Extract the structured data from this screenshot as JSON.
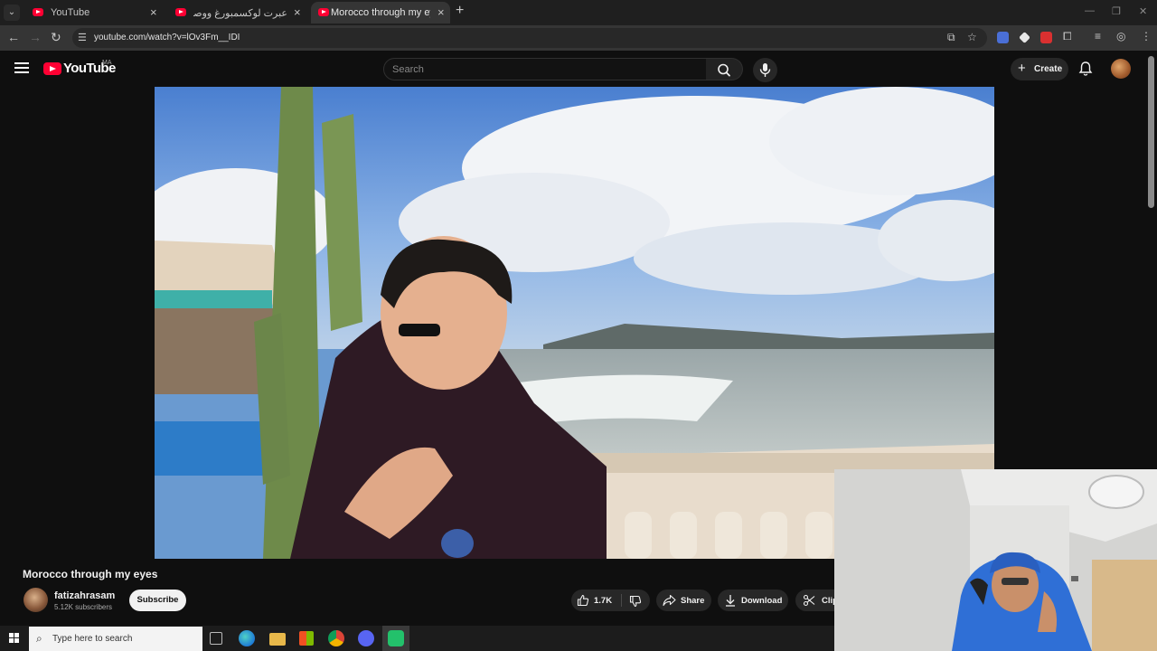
{
  "browser": {
    "tabs": [
      {
        "title": "YouTube",
        "active": false
      },
      {
        "title": "عبرت لوكسمبورغ ووصلت ضواح...",
        "active": false
      },
      {
        "title": "Morocco through my eyes - YouTube",
        "active": true
      }
    ],
    "url": "youtube.com/watch?v=lOv3Fm__IDI"
  },
  "youtube": {
    "logo_text": "YouTube",
    "country_code": "MA",
    "search_placeholder": "Search",
    "create_label": "Create"
  },
  "video": {
    "title": "Morocco through my eyes",
    "channel_name": "fatizahrasam",
    "subscribers": "5.12K subscribers",
    "subscribe_label": "Subscribe",
    "likes": "1.7K",
    "share_label": "Share",
    "download_label": "Download",
    "clip_label": "Clip"
  },
  "taskbar": {
    "search_placeholder": "Type here to search"
  },
  "colors": {
    "page_bg": "#0f0f0f",
    "youtube_red": "#ff0033",
    "pill_bg": "#272727",
    "subscribe_bg": "#f1f1f1",
    "tab_active_bg": "#353535"
  },
  "icons": [
    "tab-search-icon",
    "youtube-favicon-icon",
    "close-icon",
    "plus-icon",
    "back-icon",
    "forward-icon",
    "reload-icon",
    "site-info-icon",
    "install-icon",
    "bookmark-star-icon",
    "extensions-icon",
    "profile-icon",
    "menu-dots-icon",
    "hamburger-icon",
    "search-icon",
    "microphone-icon",
    "notifications-bell-icon",
    "like-icon",
    "dislike-icon",
    "share-icon",
    "download-icon",
    "clip-scissors-icon",
    "windows-start-icon",
    "task-view-icon",
    "edge-icon",
    "file-explorer-icon",
    "store-icon",
    "chrome-icon",
    "discord-icon"
  ]
}
